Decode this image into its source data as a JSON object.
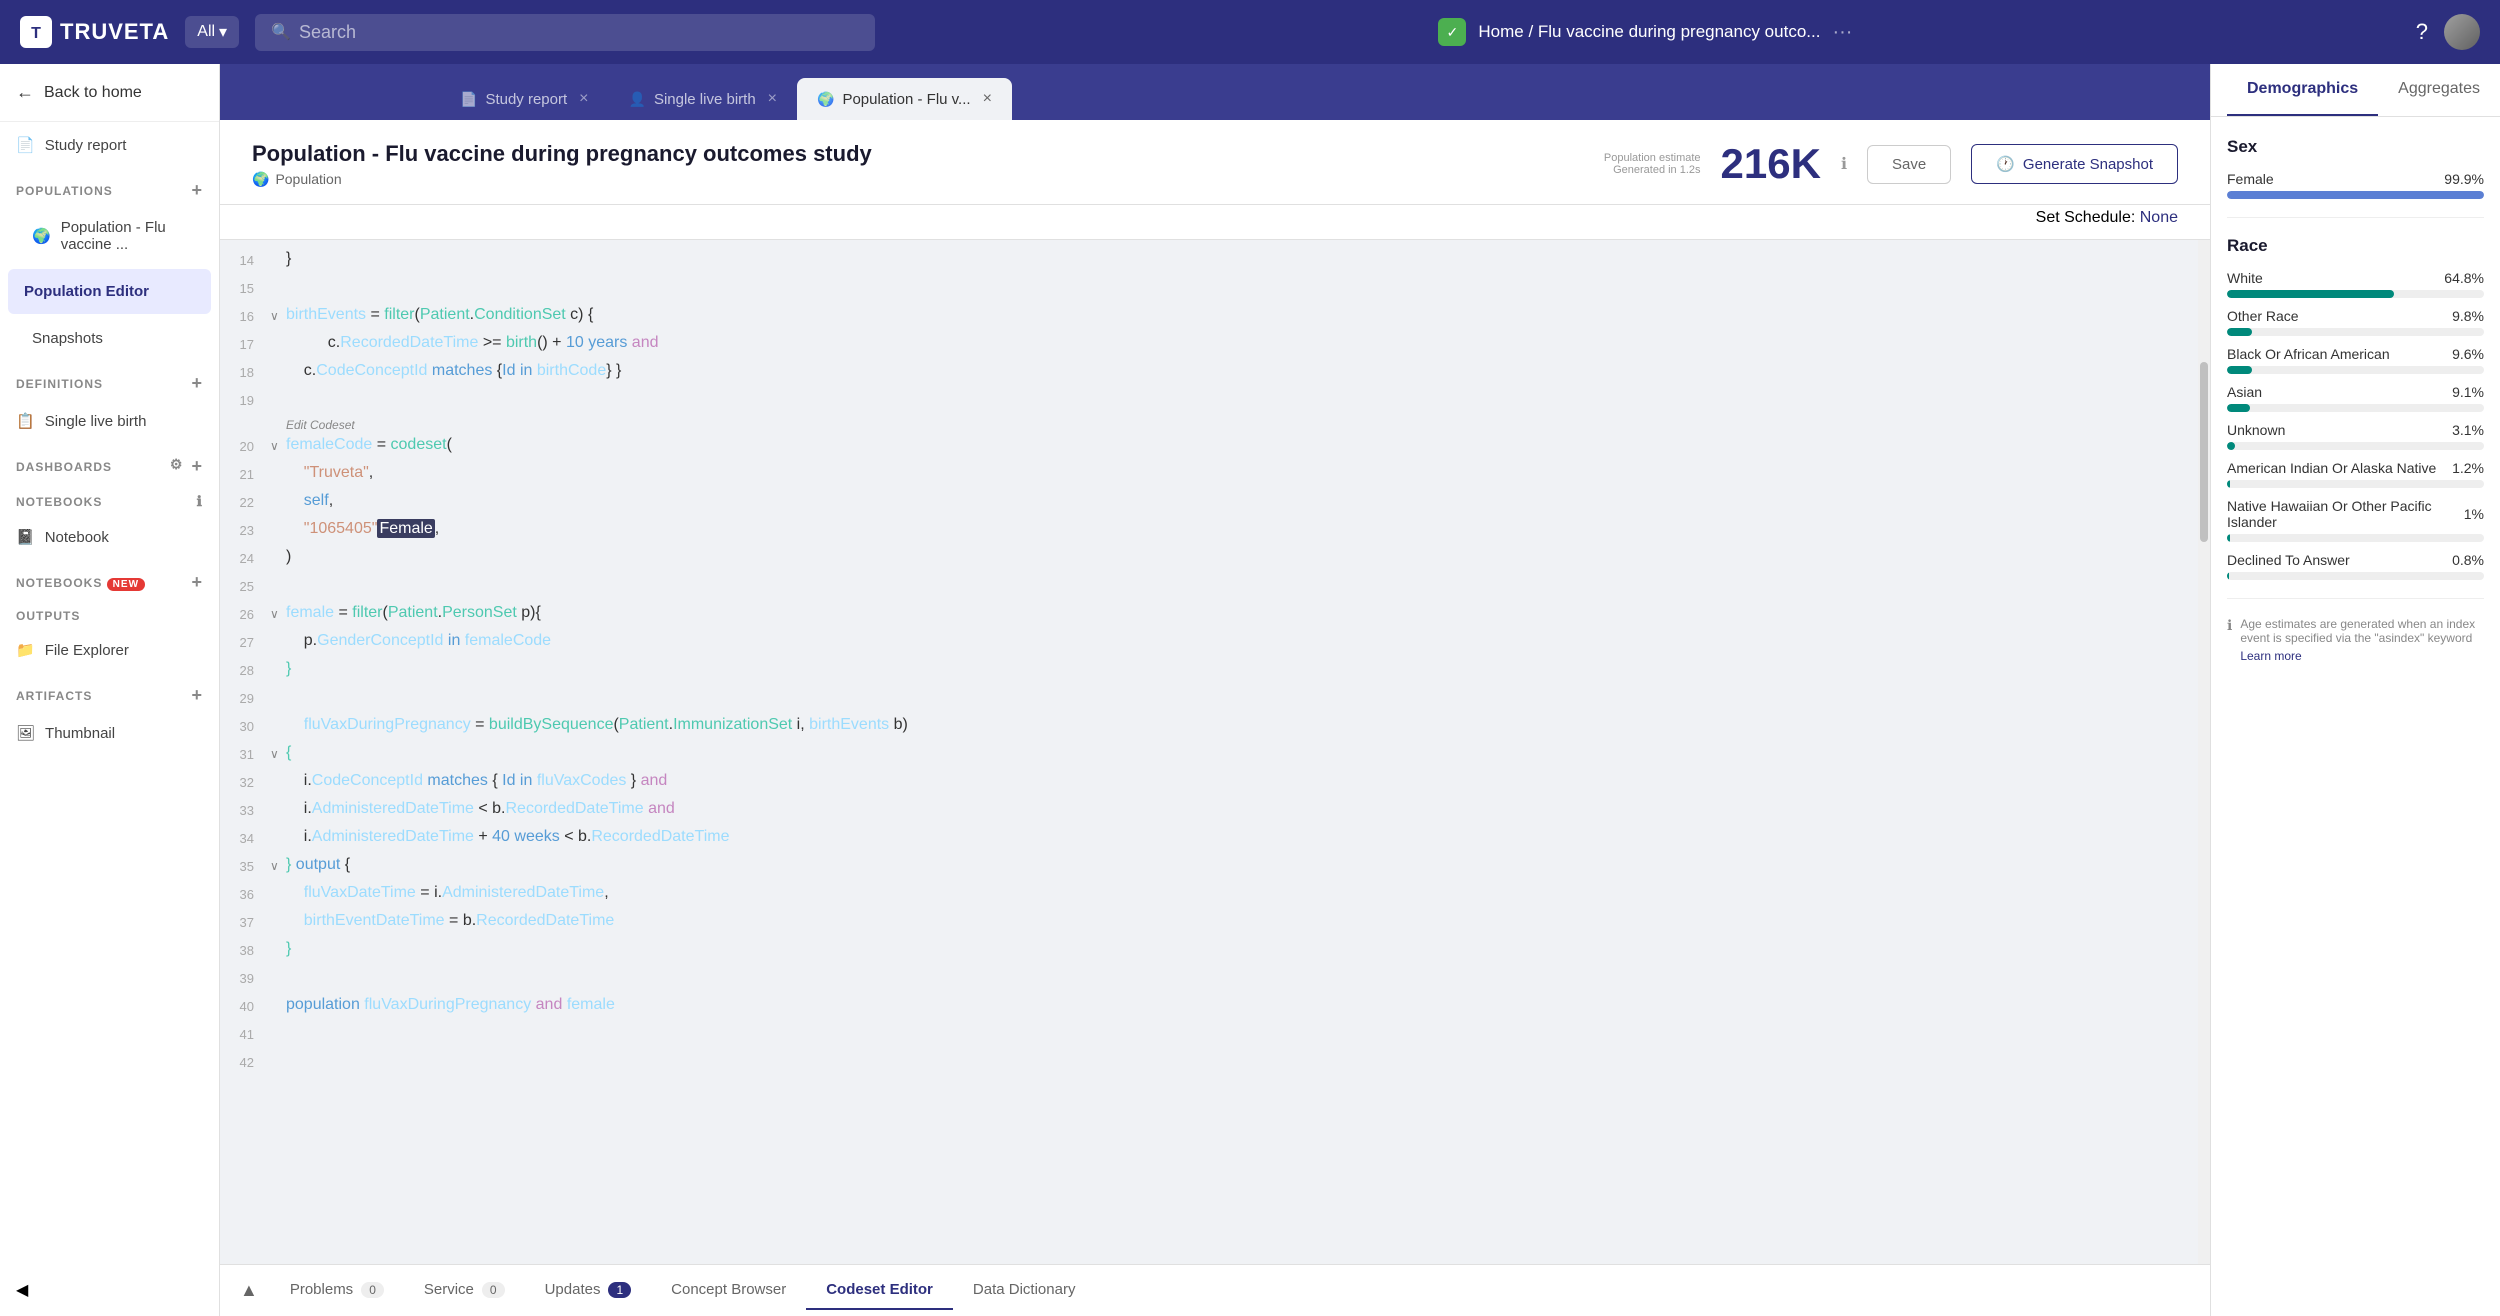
{
  "app": {
    "name": "TRUVETA"
  },
  "topnav": {
    "all_label": "All",
    "search_placeholder": "Search",
    "breadcrumb": "Home / Flu vaccine during pregnancy outco...",
    "breadcrumb_dots": "···"
  },
  "tabs": [
    {
      "id": "study-report",
      "label": "Study report",
      "icon": "📄",
      "closeable": true,
      "active": false
    },
    {
      "id": "single-live-birth",
      "label": "Single live birth",
      "icon": "👤",
      "closeable": true,
      "active": false
    },
    {
      "id": "population-flu",
      "label": "Population - Flu v...",
      "icon": "🌍",
      "closeable": true,
      "active": true
    }
  ],
  "sidebar": {
    "back_label": "Back to home",
    "study_report_label": "Study report",
    "sections": [
      {
        "id": "populations",
        "label": "POPULATIONS",
        "items": [
          {
            "id": "population-flu-item",
            "label": "Population - Flu vaccine ...",
            "active": false
          },
          {
            "id": "population-editor",
            "label": "Population Editor",
            "active": true
          },
          {
            "id": "snapshots",
            "label": "Snapshots",
            "active": false
          }
        ]
      },
      {
        "id": "definitions",
        "label": "DEFINITIONS",
        "items": [
          {
            "id": "single-live-birth-def",
            "label": "Single live birth",
            "active": false
          }
        ]
      },
      {
        "id": "dashboards",
        "label": "DASHBOARDS",
        "items": []
      },
      {
        "id": "notebooks",
        "label": "NOTEBOOKS",
        "items": [
          {
            "id": "notebook",
            "label": "Notebook",
            "active": false
          }
        ]
      },
      {
        "id": "outputs",
        "label": "OUTPUTS",
        "items": [
          {
            "id": "file-explorer",
            "label": "File Explorer",
            "active": false
          }
        ]
      },
      {
        "id": "artifacts",
        "label": "ARTIFACTS",
        "items": [
          {
            "id": "thumbnail",
            "label": "Thumbnail",
            "active": false
          }
        ]
      }
    ]
  },
  "pop_header": {
    "title": "Population - Flu vaccine during pregnancy outcomes study",
    "subtitle": "Population",
    "estimate_label": "Population estimate",
    "estimate_sublabel": "Generated in 1.2s",
    "count": "216K",
    "save_label": "Save",
    "generate_label": "Generate Snapshot",
    "schedule_label": "Set Schedule:",
    "schedule_value": "None"
  },
  "right_panel": {
    "tabs": [
      "Demographics",
      "Aggregates"
    ],
    "active_tab": "Demographics",
    "sex_section": "Sex",
    "sex_stats": [
      {
        "label": "Female",
        "pct": "99.9%",
        "value": 99.9,
        "color": "#5b7fd4"
      }
    ],
    "race_section": "Race",
    "race_stats": [
      {
        "label": "White",
        "pct": "64.8%",
        "value": 64.8,
        "color": "#00897b"
      },
      {
        "label": "Other Race",
        "pct": "9.8%",
        "value": 9.8,
        "color": "#00897b"
      },
      {
        "label": "Black Or African American",
        "pct": "9.6%",
        "value": 9.6,
        "color": "#00897b"
      },
      {
        "label": "Asian",
        "pct": "9.1%",
        "value": 9.1,
        "color": "#00897b"
      },
      {
        "label": "Unknown",
        "pct": "3.1%",
        "value": 3.1,
        "color": "#00897b"
      },
      {
        "label": "American Indian Or Alaska Native",
        "pct": "1.2%",
        "value": 1.2,
        "color": "#00897b"
      },
      {
        "label": "Native Hawaiian Or Other Pacific Islander",
        "pct": "1%",
        "value": 1.0,
        "color": "#00897b"
      },
      {
        "label": "Declined To Answer",
        "pct": "0.8%",
        "value": 0.8,
        "color": "#00897b"
      }
    ],
    "age_note": "Age estimates are generated when an index event is specified via the \"asindex\" keyword",
    "learn_more": "Learn more"
  },
  "bottom_bar": {
    "collapse_icon": "▲",
    "tabs": [
      {
        "id": "problems",
        "label": "Problems",
        "badge": "0",
        "badge_style": "normal",
        "active": false
      },
      {
        "id": "service",
        "label": "Service",
        "badge": "0",
        "badge_style": "normal",
        "active": false
      },
      {
        "id": "updates",
        "label": "Updates",
        "badge": "1",
        "badge_style": "blue",
        "active": false
      },
      {
        "id": "concept-browser",
        "label": "Concept Browser",
        "badge": "",
        "active": false
      },
      {
        "id": "codeset-editor",
        "label": "Codeset Editor",
        "badge": "",
        "active": true
      },
      {
        "id": "data-dictionary",
        "label": "Data Dictionary",
        "badge": "",
        "active": false
      }
    ]
  }
}
